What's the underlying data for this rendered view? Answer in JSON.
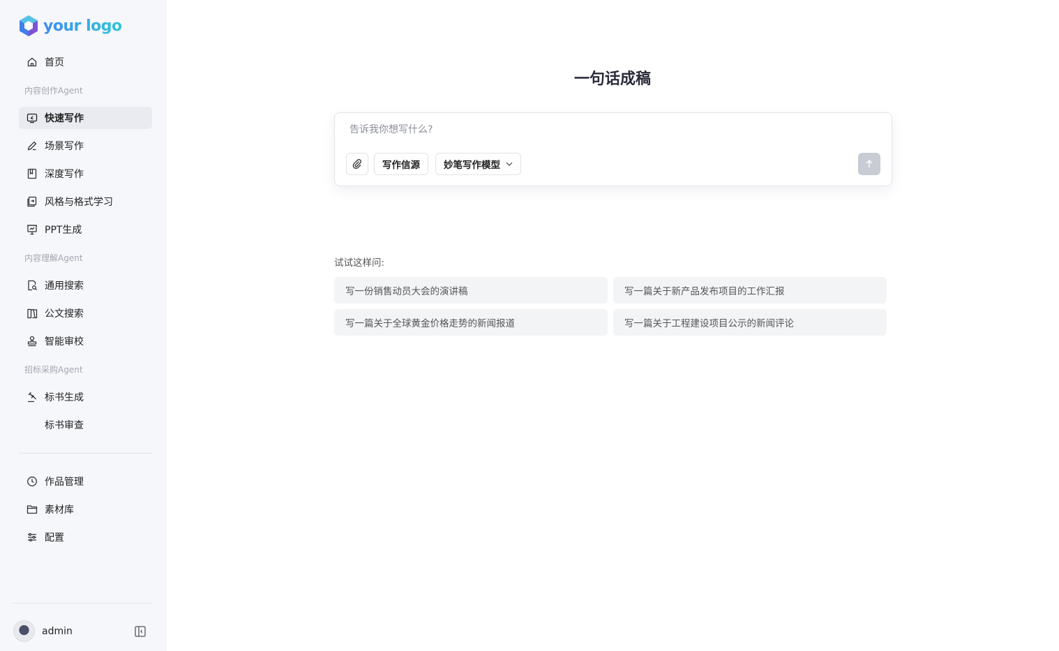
{
  "brand": {
    "logo_text": "your logo"
  },
  "sidebar": {
    "home": "首页",
    "sections": [
      {
        "label": "内容创作Agent",
        "items": [
          {
            "label": "快速写作",
            "icon": "edit-window-icon",
            "active": true
          },
          {
            "label": "场景写作",
            "icon": "pen-icon"
          },
          {
            "label": "深度写作",
            "icon": "book-icon"
          },
          {
            "label": "风格与格式学习",
            "icon": "doc-transfer-icon"
          },
          {
            "label": "PPT生成",
            "icon": "presentation-icon"
          }
        ]
      },
      {
        "label": "内容理解Agent",
        "items": [
          {
            "label": "通用搜索",
            "icon": "doc-search-icon"
          },
          {
            "label": "公文搜索",
            "icon": "book-open-icon"
          },
          {
            "label": "智能审校",
            "icon": "stamp-icon"
          }
        ]
      },
      {
        "label": "招标采购Agent",
        "items": [
          {
            "label": "标书生成",
            "icon": "gavel-icon"
          },
          {
            "label": "标书审查",
            "icon": ""
          }
        ]
      }
    ],
    "bottom_items": [
      {
        "label": "作品管理",
        "icon": "clock-icon"
      },
      {
        "label": "素材库",
        "icon": "folder-icon"
      },
      {
        "label": "配置",
        "icon": "sliders-icon"
      }
    ],
    "user": {
      "name": "admin"
    }
  },
  "main": {
    "title": "一句话成稿",
    "input_placeholder": "告诉我你想写什么?",
    "source_button": "写作信源",
    "model_select": "妙笔写作模型",
    "try_label": "试试这样问:",
    "suggestions": [
      "写一份销售动员大会的演讲稿",
      "写一篇关于新产品发布项目的工作汇报",
      "写一篇关于全球黄金价格走势的新闻报道",
      "写一篇关于工程建设项目公示的新闻评论"
    ]
  },
  "colors": {
    "active_bg": "#e9ebf1",
    "sidebar_bg": "#f6f7fb",
    "send_disabled": "#c9ccd4"
  }
}
